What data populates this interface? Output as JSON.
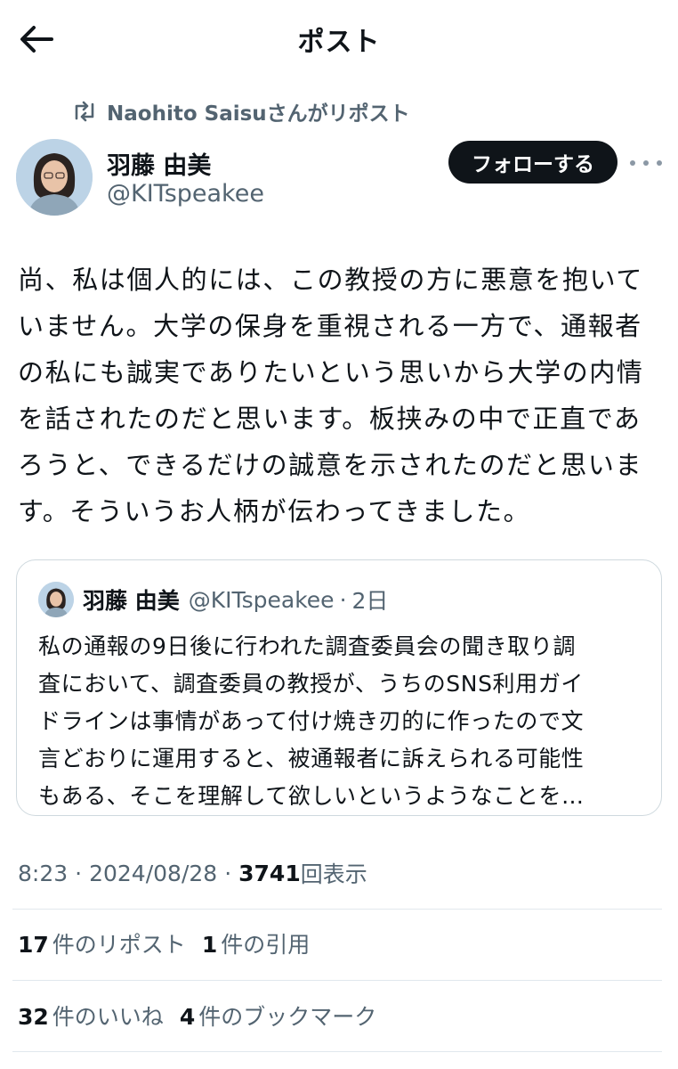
{
  "header": {
    "title": "ポスト"
  },
  "repost": {
    "text": "Naohito Saisuさんがリポスト"
  },
  "author": {
    "name": "羽藤 由美",
    "handle": "@KITspeakee",
    "follow_label": "フォローする"
  },
  "post": {
    "text": "尚、私は個人的には、この教授の方に悪意を抱いて\nいません。大学の保身を重視される一方で、通報者\nの私にも誠実でありたいという思いから大学の内情\nを話されたのだと思います。板挟みの中で正直であ\nろうと、できるだけの誠意を示されたのだと思いま\nす。そういうお人柄が伝わってきました。"
  },
  "quote": {
    "name": "羽藤 由美",
    "handle": "@KITspeakee",
    "dot": "·",
    "time": "2日",
    "text": "私の通報の9日後に行われた調査委員会の聞き取り調\n査において、調査委員の教授が、うちのSNS利用ガイ\nドラインは事情があって付け焼き刃的に作ったので文\n言どおりに運用すると、被通報者に訴えられる可能性\nもある、そこを理解して欲しいというようなことを…"
  },
  "meta": {
    "time": "8:23",
    "sep1": "·",
    "date": "2024/08/28",
    "sep2": "·",
    "views_count": "3741",
    "views_label": "回表示"
  },
  "stats": {
    "reposts_count": "17",
    "reposts_label": "件のリポスト",
    "quotes_count": "1",
    "quotes_label": "件の引用",
    "likes_count": "32",
    "likes_label": "件のいいね",
    "bookmarks_count": "4",
    "bookmarks_label": "件のブックマーク"
  },
  "icons": {
    "back": "arrow-left-icon",
    "repost": "repost-icon",
    "more": "more-icon"
  },
  "colors": {
    "text": "#0f1419",
    "secondary": "#536471",
    "follow_bg": "#0f1419",
    "border": "#cfd9de"
  }
}
